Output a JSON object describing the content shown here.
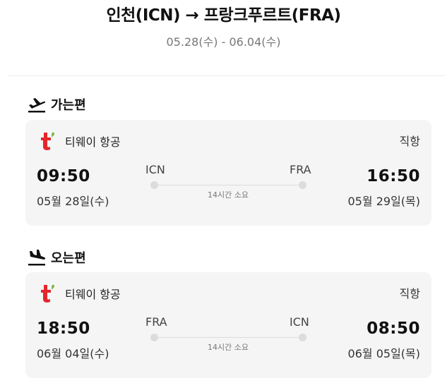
{
  "route": {
    "title": "인천(ICN) → 프랑크푸르트(FRA)",
    "dates": "05.28(수) - 06.04(수)"
  },
  "outbound": {
    "heading": "가는편",
    "airline": "티웨이 항공",
    "type": "직항",
    "dep_time": "09:50",
    "dep_date": "05월 28일(수)",
    "dep_code": "ICN",
    "arr_code": "FRA",
    "duration": "14시간 소요",
    "arr_time": "16:50",
    "arr_date": "05월 29일(목)"
  },
  "inbound": {
    "heading": "오는편",
    "airline": "티웨이 항공",
    "type": "직항",
    "dep_time": "18:50",
    "dep_date": "06월 04일(수)",
    "dep_code": "FRA",
    "arr_code": "ICN",
    "duration": "14시간 소요",
    "arr_time": "08:50",
    "arr_date": "06월 05일(목)"
  },
  "icons": {
    "departure": "airplane-takeoff-icon",
    "arrival": "airplane-landing-icon",
    "airline_logo": "tway-logo"
  },
  "colors": {
    "logo_red": "#e3262a",
    "logo_green": "#7ab642",
    "card_bg": "#f5f5f6"
  }
}
